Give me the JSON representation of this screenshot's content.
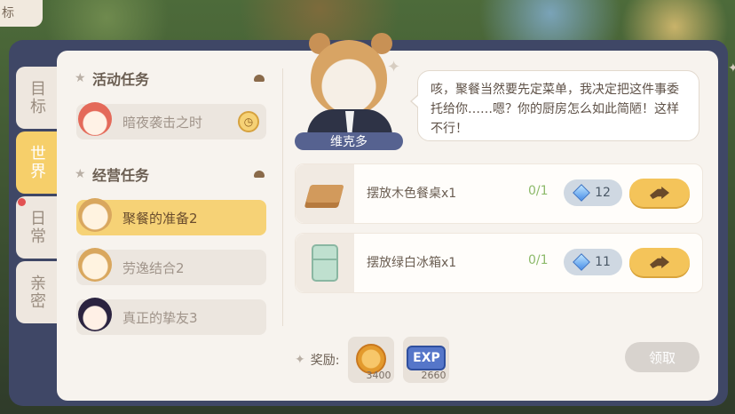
{
  "corner_tab": {
    "label": "标"
  },
  "side_tabs": [
    {
      "label": "目标",
      "active": false,
      "dot": false
    },
    {
      "label": "世界",
      "active": true,
      "dot": false
    },
    {
      "label": "日常",
      "active": false,
      "dot": true
    },
    {
      "label": "亲密",
      "active": false,
      "dot": false
    }
  ],
  "sections": {
    "event": {
      "title": "活动任务"
    },
    "business": {
      "title": "经营任务"
    }
  },
  "tasks": {
    "event": [
      {
        "label": "暗夜袭击之时",
        "icon": "clock-icon"
      }
    ],
    "business": [
      {
        "label": "聚餐的准备2",
        "active": true
      },
      {
        "label": "劳逸结合2",
        "active": false
      },
      {
        "label": "真正的挚友3",
        "active": false
      }
    ]
  },
  "npc": {
    "name": "维克多",
    "dialogue": "咳，聚餐当然要先定菜单，我决定把这件事委托给你……嗯？你的厨房怎么如此简陋！这样不行！"
  },
  "objectives": [
    {
      "desc": "摆放木色餐桌x1",
      "progress": "0/1",
      "reward": "12",
      "icon": "wooden-table-icon"
    },
    {
      "desc": "摆放绿白冰箱x1",
      "progress": "0/1",
      "reward": "11",
      "icon": "fridge-icon"
    }
  ],
  "rewards": {
    "label": "奖励:",
    "items": [
      {
        "icon": "coin-icon",
        "amount": "3400"
      },
      {
        "icon": "exp-icon",
        "text": "EXP",
        "amount": "2660"
      }
    ]
  },
  "claim_button": {
    "label": "领取"
  },
  "colors": {
    "frame": "#3f4766",
    "panel": "#f7f3ee",
    "active_tab": "#f6cf6a",
    "go_button": "#f4c45a",
    "progress_green": "#8dba6a"
  }
}
